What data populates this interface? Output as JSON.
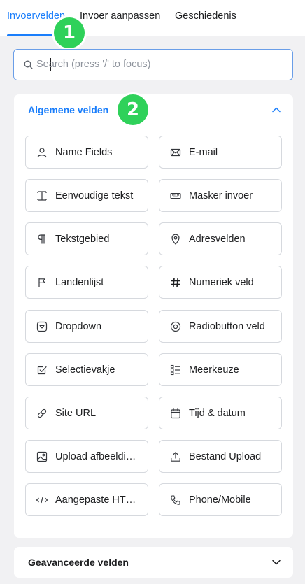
{
  "tabs": [
    {
      "label": "Invoervelden",
      "active": true
    },
    {
      "label": "Invoer aanpassen",
      "active": false
    },
    {
      "label": "Geschiedenis",
      "active": false
    }
  ],
  "badges": {
    "one": "1",
    "two": "2"
  },
  "search": {
    "placeholder": "Search (press '/' to focus)",
    "value": ""
  },
  "general": {
    "title": "Algemene velden",
    "expanded": true,
    "fields": [
      {
        "label": "Name Fields",
        "icon": "user-icon"
      },
      {
        "label": "E-mail",
        "icon": "envelope-icon"
      },
      {
        "label": "Eenvoudige tekst",
        "icon": "text-cursor-icon"
      },
      {
        "label": "Masker invoer",
        "icon": "keyboard-icon"
      },
      {
        "label": "Tekstgebied",
        "icon": "paragraph-icon"
      },
      {
        "label": "Adresvelden",
        "icon": "map-pin-icon"
      },
      {
        "label": "Landenlijst",
        "icon": "flag-icon"
      },
      {
        "label": "Numeriek veld",
        "icon": "hash-icon"
      },
      {
        "label": "Dropdown",
        "icon": "dropdown-icon"
      },
      {
        "label": "Radiobutton veld",
        "icon": "radio-icon"
      },
      {
        "label": "Selectievakje",
        "icon": "checkbox-icon"
      },
      {
        "label": "Meerkeuze",
        "icon": "list-check-icon"
      },
      {
        "label": "Site URL",
        "icon": "link-icon"
      },
      {
        "label": "Tijd & datum",
        "icon": "calendar-icon"
      },
      {
        "label": "Upload afbeeldi…",
        "icon": "image-upload-icon"
      },
      {
        "label": "Bestand Upload",
        "icon": "upload-icon"
      },
      {
        "label": "Aangepaste HT…",
        "icon": "code-icon"
      },
      {
        "label": "Phone/Mobile",
        "icon": "phone-icon"
      }
    ]
  },
  "advanced": {
    "title": "Geavanceerde velden",
    "expanded": false
  },
  "colors": {
    "accent": "#1a7efb",
    "badge": "#2fd15a",
    "background": "#f1f1f3"
  }
}
